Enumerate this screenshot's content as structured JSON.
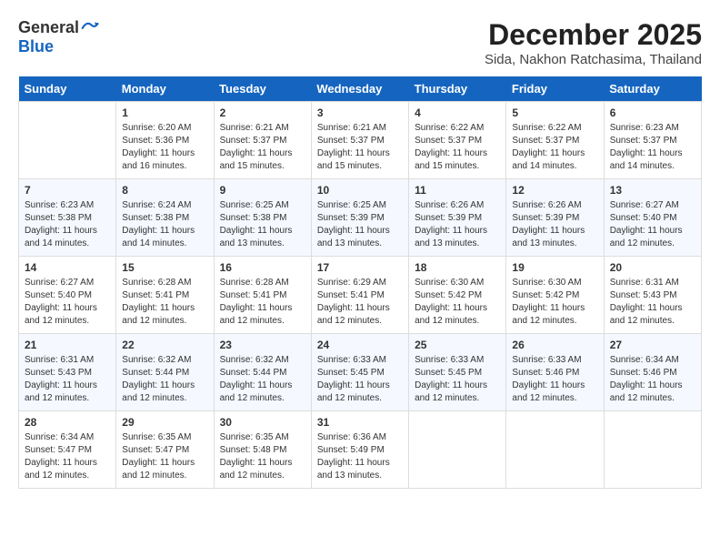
{
  "header": {
    "logo_general": "General",
    "logo_blue": "Blue",
    "month_title": "December 2025",
    "location": "Sida, Nakhon Ratchasima, Thailand"
  },
  "calendar": {
    "days_of_week": [
      "Sunday",
      "Monday",
      "Tuesday",
      "Wednesday",
      "Thursday",
      "Friday",
      "Saturday"
    ],
    "weeks": [
      [
        {
          "day": "",
          "info": ""
        },
        {
          "day": "1",
          "info": "Sunrise: 6:20 AM\nSunset: 5:36 PM\nDaylight: 11 hours\nand 16 minutes."
        },
        {
          "day": "2",
          "info": "Sunrise: 6:21 AM\nSunset: 5:37 PM\nDaylight: 11 hours\nand 15 minutes."
        },
        {
          "day": "3",
          "info": "Sunrise: 6:21 AM\nSunset: 5:37 PM\nDaylight: 11 hours\nand 15 minutes."
        },
        {
          "day": "4",
          "info": "Sunrise: 6:22 AM\nSunset: 5:37 PM\nDaylight: 11 hours\nand 15 minutes."
        },
        {
          "day": "5",
          "info": "Sunrise: 6:22 AM\nSunset: 5:37 PM\nDaylight: 11 hours\nand 14 minutes."
        },
        {
          "day": "6",
          "info": "Sunrise: 6:23 AM\nSunset: 5:37 PM\nDaylight: 11 hours\nand 14 minutes."
        }
      ],
      [
        {
          "day": "7",
          "info": "Sunrise: 6:23 AM\nSunset: 5:38 PM\nDaylight: 11 hours\nand 14 minutes."
        },
        {
          "day": "8",
          "info": "Sunrise: 6:24 AM\nSunset: 5:38 PM\nDaylight: 11 hours\nand 14 minutes."
        },
        {
          "day": "9",
          "info": "Sunrise: 6:25 AM\nSunset: 5:38 PM\nDaylight: 11 hours\nand 13 minutes."
        },
        {
          "day": "10",
          "info": "Sunrise: 6:25 AM\nSunset: 5:39 PM\nDaylight: 11 hours\nand 13 minutes."
        },
        {
          "day": "11",
          "info": "Sunrise: 6:26 AM\nSunset: 5:39 PM\nDaylight: 11 hours\nand 13 minutes."
        },
        {
          "day": "12",
          "info": "Sunrise: 6:26 AM\nSunset: 5:39 PM\nDaylight: 11 hours\nand 13 minutes."
        },
        {
          "day": "13",
          "info": "Sunrise: 6:27 AM\nSunset: 5:40 PM\nDaylight: 11 hours\nand 12 minutes."
        }
      ],
      [
        {
          "day": "14",
          "info": "Sunrise: 6:27 AM\nSunset: 5:40 PM\nDaylight: 11 hours\nand 12 minutes."
        },
        {
          "day": "15",
          "info": "Sunrise: 6:28 AM\nSunset: 5:41 PM\nDaylight: 11 hours\nand 12 minutes."
        },
        {
          "day": "16",
          "info": "Sunrise: 6:28 AM\nSunset: 5:41 PM\nDaylight: 11 hours\nand 12 minutes."
        },
        {
          "day": "17",
          "info": "Sunrise: 6:29 AM\nSunset: 5:41 PM\nDaylight: 11 hours\nand 12 minutes."
        },
        {
          "day": "18",
          "info": "Sunrise: 6:30 AM\nSunset: 5:42 PM\nDaylight: 11 hours\nand 12 minutes."
        },
        {
          "day": "19",
          "info": "Sunrise: 6:30 AM\nSunset: 5:42 PM\nDaylight: 11 hours\nand 12 minutes."
        },
        {
          "day": "20",
          "info": "Sunrise: 6:31 AM\nSunset: 5:43 PM\nDaylight: 11 hours\nand 12 minutes."
        }
      ],
      [
        {
          "day": "21",
          "info": "Sunrise: 6:31 AM\nSunset: 5:43 PM\nDaylight: 11 hours\nand 12 minutes."
        },
        {
          "day": "22",
          "info": "Sunrise: 6:32 AM\nSunset: 5:44 PM\nDaylight: 11 hours\nand 12 minutes."
        },
        {
          "day": "23",
          "info": "Sunrise: 6:32 AM\nSunset: 5:44 PM\nDaylight: 11 hours\nand 12 minutes."
        },
        {
          "day": "24",
          "info": "Sunrise: 6:33 AM\nSunset: 5:45 PM\nDaylight: 11 hours\nand 12 minutes."
        },
        {
          "day": "25",
          "info": "Sunrise: 6:33 AM\nSunset: 5:45 PM\nDaylight: 11 hours\nand 12 minutes."
        },
        {
          "day": "26",
          "info": "Sunrise: 6:33 AM\nSunset: 5:46 PM\nDaylight: 11 hours\nand 12 minutes."
        },
        {
          "day": "27",
          "info": "Sunrise: 6:34 AM\nSunset: 5:46 PM\nDaylight: 11 hours\nand 12 minutes."
        }
      ],
      [
        {
          "day": "28",
          "info": "Sunrise: 6:34 AM\nSunset: 5:47 PM\nDaylight: 11 hours\nand 12 minutes."
        },
        {
          "day": "29",
          "info": "Sunrise: 6:35 AM\nSunset: 5:47 PM\nDaylight: 11 hours\nand 12 minutes."
        },
        {
          "day": "30",
          "info": "Sunrise: 6:35 AM\nSunset: 5:48 PM\nDaylight: 11 hours\nand 12 minutes."
        },
        {
          "day": "31",
          "info": "Sunrise: 6:36 AM\nSunset: 5:49 PM\nDaylight: 11 hours\nand 13 minutes."
        },
        {
          "day": "",
          "info": ""
        },
        {
          "day": "",
          "info": ""
        },
        {
          "day": "",
          "info": ""
        }
      ]
    ]
  }
}
